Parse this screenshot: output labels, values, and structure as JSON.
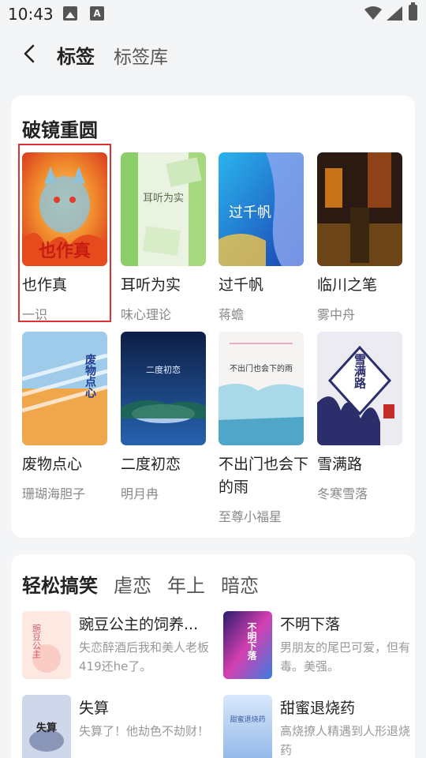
{
  "status": {
    "time": "10:43"
  },
  "header": {
    "tabs": [
      {
        "label": "标签",
        "active": true
      },
      {
        "label": "标签库",
        "active": false
      }
    ]
  },
  "section1": {
    "title": "破镜重圆",
    "books": [
      {
        "title": "也作真",
        "author": "一识",
        "cover_text": "也作真"
      },
      {
        "title": "耳听为实",
        "author": "味心理论",
        "cover_text": "耳听为实"
      },
      {
        "title": "过千帆",
        "author": "蒋蟾",
        "cover_text": "过千帆"
      },
      {
        "title": "临川之笔",
        "author": "雾中舟",
        "cover_text": ""
      },
      {
        "title": "废物点心",
        "author": "珊瑚海胆子",
        "cover_text": "废物点心"
      },
      {
        "title": "二度初恋",
        "author": "明月冉",
        "cover_text": "二度初恋"
      },
      {
        "title": "不出门也会下的雨",
        "author": "至尊小福星",
        "cover_text": "不出门也会下的雨"
      },
      {
        "title": "雪满路",
        "author": "冬寒雪落",
        "cover_text": "雪满路"
      }
    ]
  },
  "section2": {
    "categories": [
      {
        "label": "轻松搞笑",
        "active": true
      },
      {
        "label": "虐恋",
        "active": false
      },
      {
        "label": "年上",
        "active": false
      },
      {
        "label": "暗恋",
        "active": false
      }
    ],
    "items": [
      {
        "title": "豌豆公主的饲养...",
        "desc": "失恋醉酒后我和美人老板419还he了。",
        "cover_text": "豌豆公主"
      },
      {
        "title": "不明下落",
        "desc": "男朋友的尾巴可爱，但有毒。美强。",
        "cover_text": "不明下落"
      },
      {
        "title": "失算",
        "desc": "失算了！他劫色不劫财！",
        "cover_text": "失算"
      },
      {
        "title": "甜蜜退烧药",
        "desc": "高烧撩人精遇到人形退烧药",
        "cover_text": "甜蜜退烧药"
      }
    ]
  }
}
